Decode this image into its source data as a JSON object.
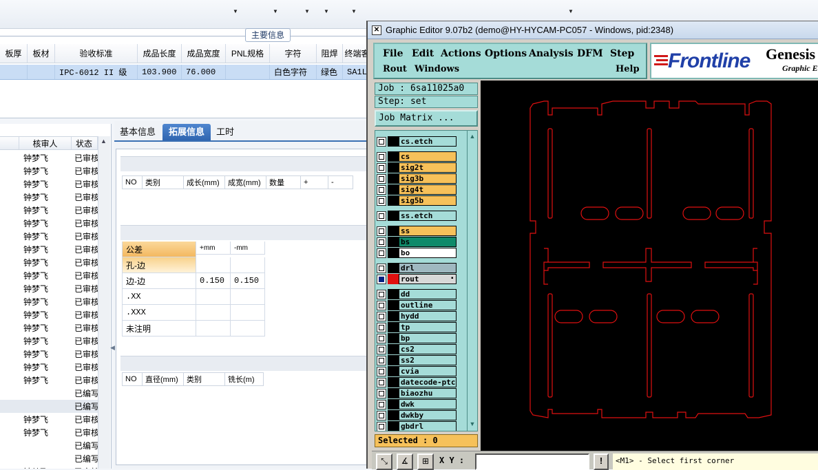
{
  "background_app": {
    "main_info_label": "主要信息",
    "top_grid": {
      "headers": [
        "板厚",
        "板材",
        "验收标准",
        "成品长度",
        "成品宽度",
        "PNL规格",
        "字符",
        "阻焊",
        "终端客"
      ],
      "row": [
        "",
        "",
        "IPC-6012 II 级",
        "103.900",
        "76.000",
        "",
        "白色字符",
        "绿色",
        "SA1L"
      ]
    },
    "left_list": {
      "headers": [
        "核审人",
        "状态"
      ],
      "rows": [
        [
          "钟梦飞",
          "已审核"
        ],
        [
          "钟梦飞",
          "已审核"
        ],
        [
          "钟梦飞",
          "已审核"
        ],
        [
          "钟梦飞",
          "已审核"
        ],
        [
          "钟梦飞",
          "已审核"
        ],
        [
          "钟梦飞",
          "已审核"
        ],
        [
          "钟梦飞",
          "已审核"
        ],
        [
          "钟梦飞",
          "已审核"
        ],
        [
          "钟梦飞",
          "已审核"
        ],
        [
          "钟梦飞",
          "已审核"
        ],
        [
          "钟梦飞",
          "已审核"
        ],
        [
          "钟梦飞",
          "已审核"
        ],
        [
          "钟梦飞",
          "已审核"
        ],
        [
          "钟梦飞",
          "已审核"
        ],
        [
          "钟梦飞",
          "已审核"
        ],
        [
          "钟梦飞",
          "已审核"
        ],
        [
          "钟梦飞",
          "已审核"
        ],
        [
          "钟梦飞",
          "已审核"
        ],
        [
          "",
          "已编写"
        ],
        [
          "",
          "已编写"
        ],
        [
          "钟梦飞",
          "已审核"
        ],
        [
          "钟梦飞",
          "已审核"
        ],
        [
          "",
          "已编写"
        ],
        [
          "",
          "已编写"
        ],
        [
          "钟梦飞",
          "已审核"
        ],
        [
          "钟梦飞",
          "已审核"
        ]
      ]
    },
    "tabs": [
      "基本信息",
      "拓展信息",
      "工时"
    ],
    "grid1_headers": [
      "NO",
      "类别",
      "成长(mm)",
      "成宽(mm)",
      "数量",
      "+",
      "-"
    ],
    "tolerance": {
      "headers": [
        "公差",
        "+mm",
        "-mm"
      ],
      "rows": [
        [
          "孔-边",
          "",
          ""
        ],
        [
          "边-边",
          "0.150",
          "0.150"
        ],
        [
          ".XX",
          "",
          ""
        ],
        [
          ".XXX",
          "",
          ""
        ],
        [
          "未注明",
          "",
          ""
        ]
      ]
    },
    "grid2_headers": [
      "NO",
      "直径(mm)",
      "类别",
      "铣长(m)"
    ]
  },
  "genesis": {
    "title": "Graphic Editor 9.07b2 (demo@HY-HYCAM-PC057 - Windows, pid:2348)",
    "menu": {
      "file": "File",
      "edit": "Edit",
      "actions": "Actions",
      "options": "Options",
      "analysis": "Analysis",
      "dfm": "DFM",
      "step": "Step",
      "rout": "Rout",
      "windows": "Windows",
      "help": "Help"
    },
    "logo": {
      "brand": "Frontline",
      "product": "Genesis",
      "sub": "Graphic E"
    },
    "job": "Job : 6sa11025a0",
    "step": "Step: set",
    "job_matrix": "Job Matrix ...",
    "layers": [
      {
        "name": "cs.etch",
        "color": "#a5dcd8",
        "checked": false
      },
      {
        "name": "cs",
        "color": "#f6c15a",
        "checked": false
      },
      {
        "name": "sig2t",
        "color": "#f6c15a",
        "checked": false
      },
      {
        "name": "sig3b",
        "color": "#f6c15a",
        "checked": false
      },
      {
        "name": "sig4t",
        "color": "#f6c15a",
        "checked": false
      },
      {
        "name": "sig5b",
        "color": "#f6c15a",
        "checked": false
      },
      {
        "name": "ss.etch",
        "color": "#a5dcd8",
        "checked": false
      },
      {
        "name": "ss",
        "color": "#f6c15a",
        "checked": false
      },
      {
        "name": "bs",
        "color": "#0f8a6a",
        "checked": false
      },
      {
        "name": "bo",
        "color": "#ffffff",
        "checked": false
      },
      {
        "name": "drl",
        "color": "#9fb8c0",
        "checked": false
      },
      {
        "name": "rout",
        "color": "#d8d8d8",
        "checked": true
      },
      {
        "name": "dd",
        "color": "#a5dcd8",
        "checked": false
      },
      {
        "name": "outline",
        "color": "#a5dcd8",
        "checked": false
      },
      {
        "name": "hydd",
        "color": "#a5dcd8",
        "checked": false
      },
      {
        "name": "tp",
        "color": "#a5dcd8",
        "checked": false
      },
      {
        "name": "bp",
        "color": "#a5dcd8",
        "checked": false
      },
      {
        "name": "cs2",
        "color": "#a5dcd8",
        "checked": false
      },
      {
        "name": "ss2",
        "color": "#a5dcd8",
        "checked": false
      },
      {
        "name": "cvia",
        "color": "#a5dcd8",
        "checked": false
      },
      {
        "name": "datecode-ptc",
        "color": "#a5dcd8",
        "checked": false
      },
      {
        "name": "biaozhu",
        "color": "#a5dcd8",
        "checked": false
      },
      {
        "name": "dwk",
        "color": "#a5dcd8",
        "checked": false
      },
      {
        "name": "dwkby",
        "color": "#a5dcd8",
        "checked": false
      },
      {
        "name": "gbdrl",
        "color": "#a5dcd8",
        "checked": false
      }
    ],
    "selected": "Selected : 0",
    "xy_label": "X Y :",
    "status_message": "<M1> - Select first corner",
    "alert_label": "!",
    "colors": {
      "panel": "#a5dcd8",
      "rout_line": "#e01010",
      "canvas": "#000000"
    }
  }
}
